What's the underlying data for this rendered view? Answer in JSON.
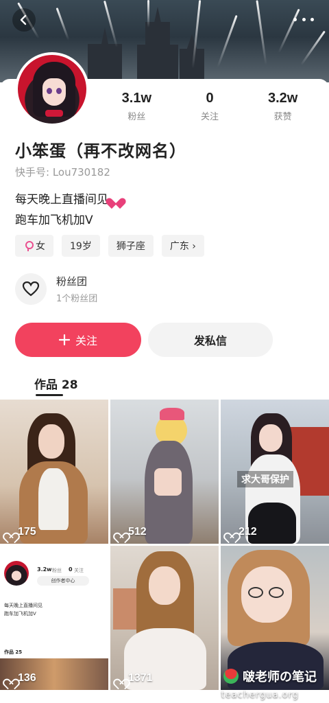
{
  "profile": {
    "name": "小笨蛋（再不改网名）",
    "uid": "快手号: Lou730182",
    "bio_line1": "每天晚上直播间见",
    "bio_line2": "跑车加飞机加V"
  },
  "stats": [
    {
      "value": "3.1w",
      "label": "粉丝"
    },
    {
      "value": "0",
      "label": "关注"
    },
    {
      "value": "3.2w",
      "label": "获赞"
    }
  ],
  "tags": {
    "gender": "女",
    "age": "19岁",
    "zodiac": "狮子座",
    "region": "广东 ›"
  },
  "fanclub": {
    "title": "粉丝团",
    "subtitle": "1个粉丝团"
  },
  "actions": {
    "follow_label": "关注",
    "message_label": "发私信"
  },
  "tabs": {
    "works_label": "作品 28"
  },
  "videos": [
    {
      "likes": "175"
    },
    {
      "likes": "512"
    },
    {
      "likes": "212",
      "caption": "求大哥保护"
    },
    {
      "likes": "136"
    },
    {
      "likes": "1371"
    },
    {
      "likes": ""
    }
  ],
  "mini_profile": {
    "fans": "3.2w",
    "fans_label": "粉丝",
    "follow": "0",
    "follow_label": "关注",
    "creator": "创作者中心",
    "bio1": "每天晚上直播间见",
    "bio2": "跑车加飞机加V",
    "works_tab": "作品 25"
  },
  "watermark": {
    "text": "啵老师の笔记",
    "url": "teachergua.org"
  }
}
